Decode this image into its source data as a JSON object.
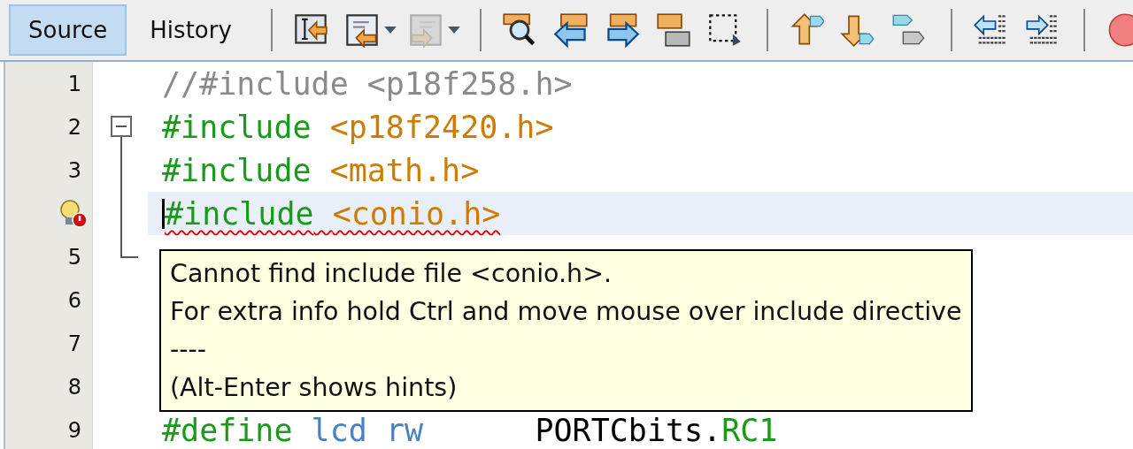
{
  "tabs": [
    {
      "label": "Source",
      "selected": true
    },
    {
      "label": "History",
      "selected": false
    }
  ],
  "toolbar_groups": [
    [
      {
        "disabled": false,
        "dropdown": false
      },
      {
        "disabled": false,
        "dropdown": true
      },
      {
        "disabled": true,
        "dropdown": true
      }
    ],
    [
      {
        "disabled": false,
        "dropdown": false
      },
      {
        "disabled": false,
        "dropdown": false
      },
      {
        "disabled": false,
        "dropdown": false
      },
      {
        "disabled": false,
        "dropdown": false
      },
      {
        "disabled": false,
        "dropdown": false
      }
    ],
    [
      {
        "disabled": false,
        "dropdown": false
      },
      {
        "disabled": false,
        "dropdown": false
      },
      {
        "disabled": false,
        "dropdown": false
      }
    ],
    [
      {
        "disabled": false,
        "dropdown": false
      },
      {
        "disabled": false,
        "dropdown": false
      }
    ],
    [
      {
        "disabled": false,
        "dropdown": false
      }
    ]
  ],
  "editor": {
    "lines": [
      {
        "number": "1",
        "fold_open": false,
        "in_fold": false,
        "fold_end": false,
        "current": false,
        "error": false,
        "tokens": [
          {
            "kind": "comment",
            "text": "//#include <p18f258.h>"
          }
        ]
      },
      {
        "number": "2",
        "fold_open": true,
        "in_fold": false,
        "fold_end": false,
        "current": false,
        "error": false,
        "tokens": [
          {
            "kind": "directive",
            "text": "#include"
          },
          {
            "kind": "header",
            "text": "<p18f2420.h>"
          }
        ]
      },
      {
        "number": "3",
        "fold_open": false,
        "in_fold": true,
        "fold_end": false,
        "current": false,
        "error": false,
        "tokens": [
          {
            "kind": "directive",
            "text": "#include"
          },
          {
            "kind": "header",
            "text": "<math.h>"
          }
        ]
      },
      {
        "fold_open": false,
        "in_fold": true,
        "fold_end": false,
        "current": true,
        "error": true,
        "tokens": [
          {
            "kind": "directive",
            "text": "#include"
          },
          {
            "kind": "header",
            "text": "<conio.h>"
          }
        ]
      },
      {
        "number": "5",
        "fold_open": false,
        "in_fold": false,
        "fold_end": true,
        "current": false,
        "error": false
      },
      {
        "number": "6",
        "fold_open": false,
        "in_fold": false,
        "fold_end": false,
        "current": false,
        "error": false
      },
      {
        "number": "7",
        "fold_open": false,
        "in_fold": false,
        "fold_end": false,
        "current": false,
        "error": false
      },
      {
        "number": "8",
        "fold_open": false,
        "in_fold": false,
        "fold_end": false,
        "current": false,
        "error": false
      },
      {
        "number": "9",
        "fold_open": false,
        "in_fold": false,
        "fold_end": false,
        "current": false,
        "error": false,
        "tokens": [
          {
            "kind": "directive",
            "text": "#define"
          },
          {
            "kind": "macro",
            "text": "lcd rw"
          },
          {
            "kind": "plain",
            "text": "     PORTCbits."
          },
          {
            "kind": "field",
            "text": "RC1",
            "attached": true
          }
        ]
      }
    ]
  },
  "tooltip": {
    "lines": [
      "Cannot find include file <conio.h>.",
      "For extra info hold Ctrl and move mouse over include directive",
      "----",
      "(Alt-Enter shows hints)"
    ]
  }
}
